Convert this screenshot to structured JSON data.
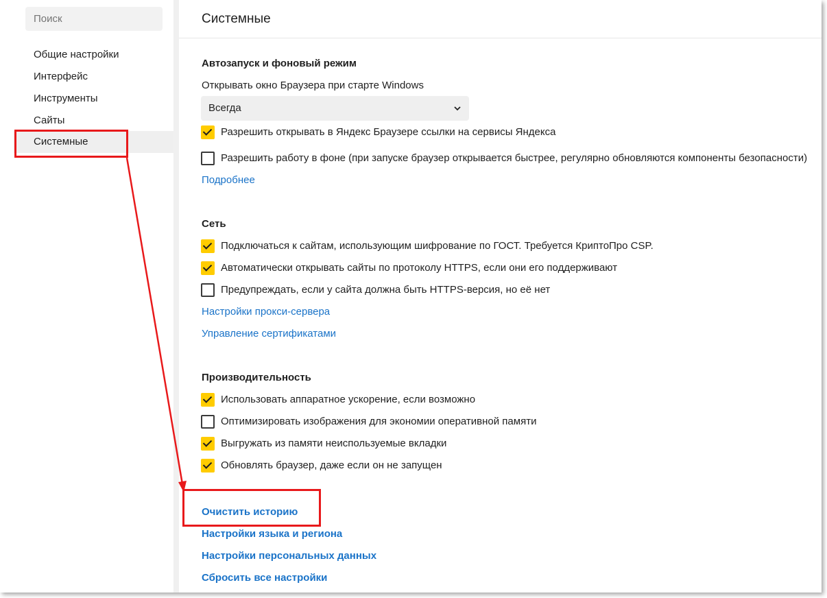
{
  "sidebar": {
    "search_placeholder": "Поиск",
    "items": [
      {
        "label": "Общие настройки",
        "active": false
      },
      {
        "label": "Интерфейс",
        "active": false
      },
      {
        "label": "Инструменты",
        "active": false
      },
      {
        "label": "Сайты",
        "active": false
      },
      {
        "label": "Системные",
        "active": true
      }
    ]
  },
  "page": {
    "title": "Системные"
  },
  "autostart": {
    "heading": "Автозапуск и фоновый режим",
    "open_label": "Открывать окно Браузера при старте Windows",
    "select_value": "Всегда",
    "checkboxes": [
      {
        "label": "Разрешить открывать в Яндекс Браузере ссылки на сервисы Яндекса",
        "checked": true
      },
      {
        "label": "Разрешить работу в фоне (при запуске браузер открывается быстрее, регулярно обновляются компоненты безопасности)",
        "checked": false
      }
    ],
    "more_link": "Подробнее"
  },
  "network": {
    "heading": "Сеть",
    "checkboxes": [
      {
        "label": "Подключаться к сайтам, использующим шифрование по ГОСТ. Требуется КриптоПро CSP.",
        "checked": true
      },
      {
        "label": "Автоматически открывать сайты по протоколу HTTPS, если они его поддерживают",
        "checked": true
      },
      {
        "label": "Предупреждать, если у сайта должна быть HTTPS-версия, но её нет",
        "checked": false
      }
    ],
    "proxy_link": "Настройки прокси-сервера",
    "certs_link": "Управление сертификатами"
  },
  "performance": {
    "heading": "Производительность",
    "checkboxes": [
      {
        "label": "Использовать аппаратное ускорение, если возможно",
        "checked": true
      },
      {
        "label": "Оптимизировать изображения для экономии оперативной памяти",
        "checked": false
      },
      {
        "label": "Выгружать из памяти неиспользуемые вкладки",
        "checked": true
      },
      {
        "label": "Обновлять браузер, даже если он не запущен",
        "checked": true
      }
    ]
  },
  "actions": {
    "clear_history": "Очистить историю",
    "language_region": "Настройки языка и региона",
    "personal_data": "Настройки персональных данных",
    "reset_all": "Сбросить все настройки"
  },
  "colors": {
    "accent_checkbox": "#ffcc00",
    "link": "#1a73c8",
    "annotation_red": "#e8191b"
  }
}
